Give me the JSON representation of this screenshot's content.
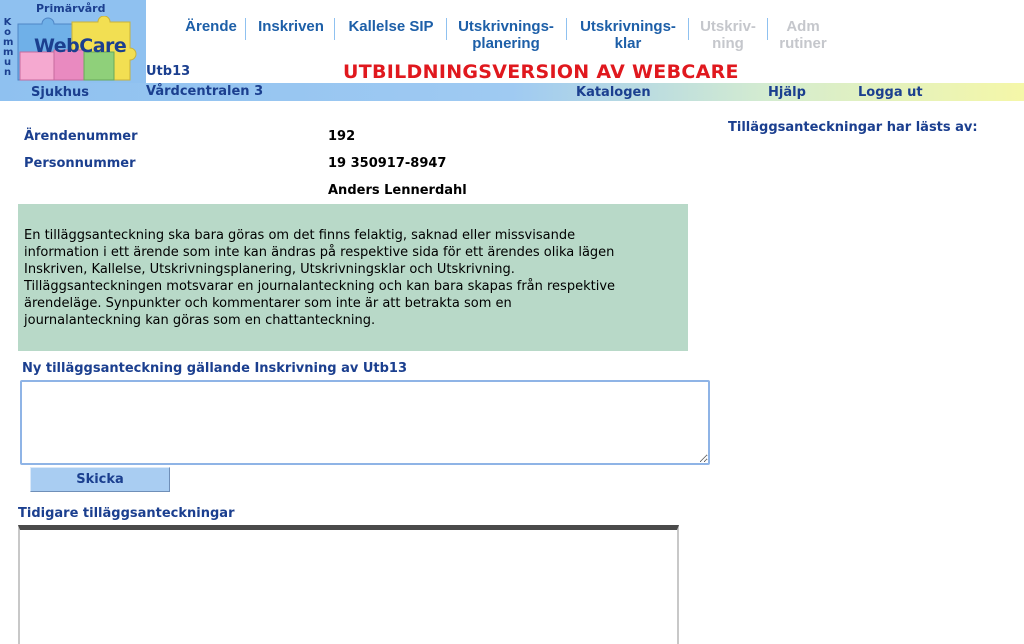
{
  "logo": {
    "top_text": "Primärvård",
    "side_text": "Kommun",
    "brand": "WebCare"
  },
  "nav": [
    {
      "line1": "Ärende",
      "line2": "",
      "enabled": true
    },
    {
      "line1": "Inskriven",
      "line2": "",
      "enabled": true
    },
    {
      "line1": "Kallelse SIP",
      "line2": "",
      "enabled": true
    },
    {
      "line1": "Utskrivnings-",
      "line2": "planering",
      "enabled": true
    },
    {
      "line1": "Utskrivnings-",
      "line2": "klar",
      "enabled": true
    },
    {
      "line1": "Utskriv-",
      "line2": "ning",
      "enabled": false
    },
    {
      "line1": "Adm",
      "line2": "rutiner",
      "enabled": false
    }
  ],
  "header": {
    "unit_code": "Utb13",
    "banner": "UTBILDNINGSVERSION AV WEBCARE"
  },
  "bar": {
    "left": "Sjukhus",
    "unit_name": "Vårdcentralen 3",
    "catalog": "Katalogen",
    "help": "Hjälp",
    "logout": "Logga ut"
  },
  "info": {
    "case_label": "Ärendenummer",
    "case_value": "192",
    "pnr_label": "Personnummer",
    "pnr_value": "19 350917-8947",
    "name_value": "Anders Lennerdahl"
  },
  "read_by_label": "Tilläggsanteckningar har lästs av:",
  "notice": "En tilläggsanteckning ska bara göras om det finns felaktig, saknad eller missvisande\ninformation i ett ärende som inte kan ändras på respektive sida för ett ärendes olika lägen\nInskriven, Kallelse, Utskrivningsplanering, Utskrivningsklar och Utskrivning.\nTilläggsanteckningen motsvarar en journalanteckning och kan bara skapas från respektive\närendeläge. Synpunkter och kommentarer som inte är att betrakta som en\njournalanteckning kan göras som en chattanteckning.",
  "new_note": {
    "label": "Ny tilläggsanteckning gällande Inskrivning av Utb13",
    "value": "",
    "send_label": "Skicka"
  },
  "previous_notes_label": "Tidigare tilläggsanteckningar",
  "colors": {
    "nav_blue": "#1d5fa8",
    "label_blue": "#1b3f8f",
    "banner_red": "#e0181e",
    "notice_bg": "#b8d9c8",
    "logo_bg": "#8fc1f0"
  }
}
